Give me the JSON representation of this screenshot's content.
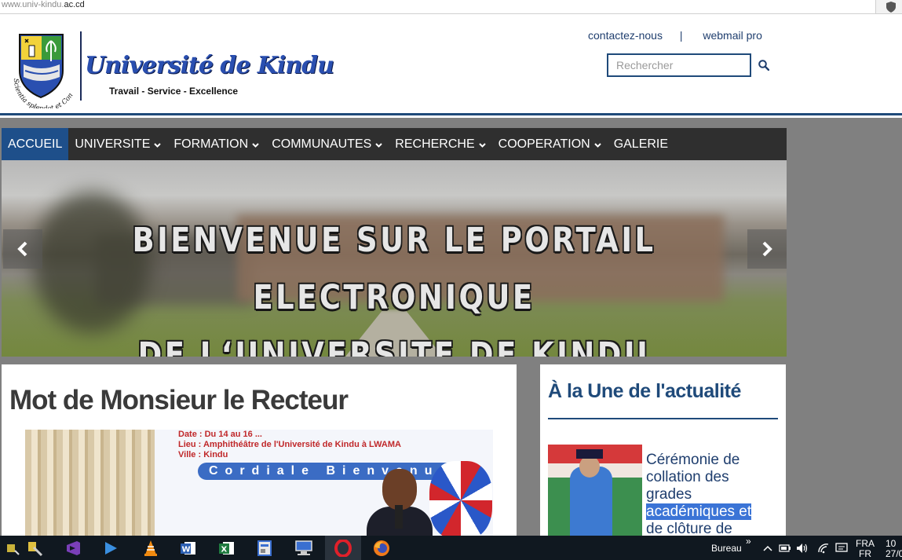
{
  "browser": {
    "url_prefix": "www.univ-kindu.",
    "url_domain": "ac.cd"
  },
  "header": {
    "logo_title": "Université de Kindu",
    "crest_motto": "Scientia splendet et Conscientia",
    "tagline": "Travail - Service - Excellence",
    "links": {
      "contact": "contactez-nous",
      "separator": "|",
      "webmail": "webmail pro"
    },
    "search": {
      "placeholder": "Rechercher",
      "value": ""
    }
  },
  "nav": {
    "items": [
      {
        "label": "ACCUEIL",
        "active": true,
        "dropdown": false
      },
      {
        "label": "UNIVERSITE",
        "active": false,
        "dropdown": true
      },
      {
        "label": "FORMATION",
        "active": false,
        "dropdown": true
      },
      {
        "label": "COMMUNAUTES",
        "active": false,
        "dropdown": true
      },
      {
        "label": "RECHERCHE",
        "active": false,
        "dropdown": true
      },
      {
        "label": "COOPERATION",
        "active": false,
        "dropdown": true
      },
      {
        "label": "GALERIE",
        "active": false,
        "dropdown": false
      }
    ]
  },
  "slider": {
    "line1": "BIENVENUE SUR LE PORTAIL ELECTRONIQUE",
    "line2": "DE L‘UNIVERSITE DE KINDU"
  },
  "recteur": {
    "title": "Mot de Monsieur le Recteur",
    "photo_banner": {
      "line1": "Date : Du 14 au 16 ...",
      "line2": "Lieu : Amphithéâtre de l'Université de Kindu à LWAMA",
      "line3": "Ville : Kindu",
      "strip": "Cordiale Bienvenue"
    }
  },
  "news": {
    "heading": "À la Une de l'actualité",
    "item": {
      "title_line1": "Cérémonie de",
      "title_line2": "collation des",
      "title_line3": "grades",
      "title_highlight": "académiques et",
      "title_line5": "de clôture de"
    }
  },
  "taskbar": {
    "toolbar_label": "Bureau",
    "toolbar_chevron": "»",
    "lang_top": "FRA",
    "lang_bottom": "FR",
    "clock_top": "10",
    "clock_bottom": "27/0"
  },
  "colors": {
    "accent": "#1f4a7a",
    "nav_bg": "#2f2f2f",
    "nav_active": "#1e4f8a",
    "page_bg": "#808080",
    "taskbar_bg": "#101820"
  }
}
